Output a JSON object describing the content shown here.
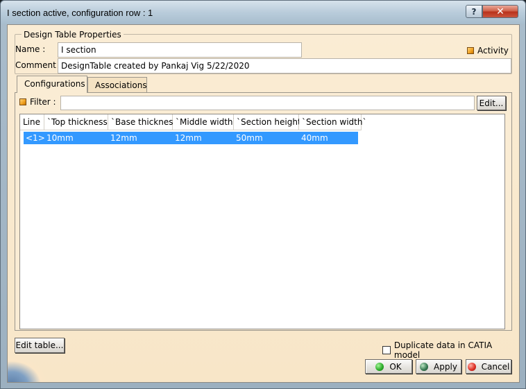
{
  "window": {
    "title": "I section active, configuration row : 1",
    "help_glyph": "?",
    "close_glyph": "✕"
  },
  "properties": {
    "legend": "Design Table Properties",
    "name_label": "Name :",
    "name_value": "I section",
    "comment_label": "Comment :",
    "comment_value": "DesignTable created by Pankaj Vig 5/22/2020",
    "activity_label": "Activity"
  },
  "tabs": [
    {
      "label": "Configurations",
      "active": true
    },
    {
      "label": "Associations",
      "active": false
    }
  ],
  "filter": {
    "label": "Filter :",
    "value": "",
    "edit_button": "Edit..."
  },
  "table": {
    "columns": [
      "Line",
      "`Top thickness`",
      "`Base thickness`",
      "`Middle width`",
      "`Section height`",
      "`Section width`"
    ],
    "rows": [
      {
        "selected": true,
        "cells": [
          "<1>",
          "10mm",
          "12mm",
          "12mm",
          "50mm",
          "40mm"
        ]
      }
    ]
  },
  "footer": {
    "edit_table_button": "Edit table...",
    "duplicate_label": "Duplicate data in CATIA model",
    "duplicate_checked": false,
    "ok_button": "OK",
    "apply_button": "Apply",
    "cancel_button": "Cancel"
  },
  "colors": {
    "client_bg": "#faecd4",
    "selection": "#3399ff",
    "activity_indicator": "#f0a020"
  }
}
